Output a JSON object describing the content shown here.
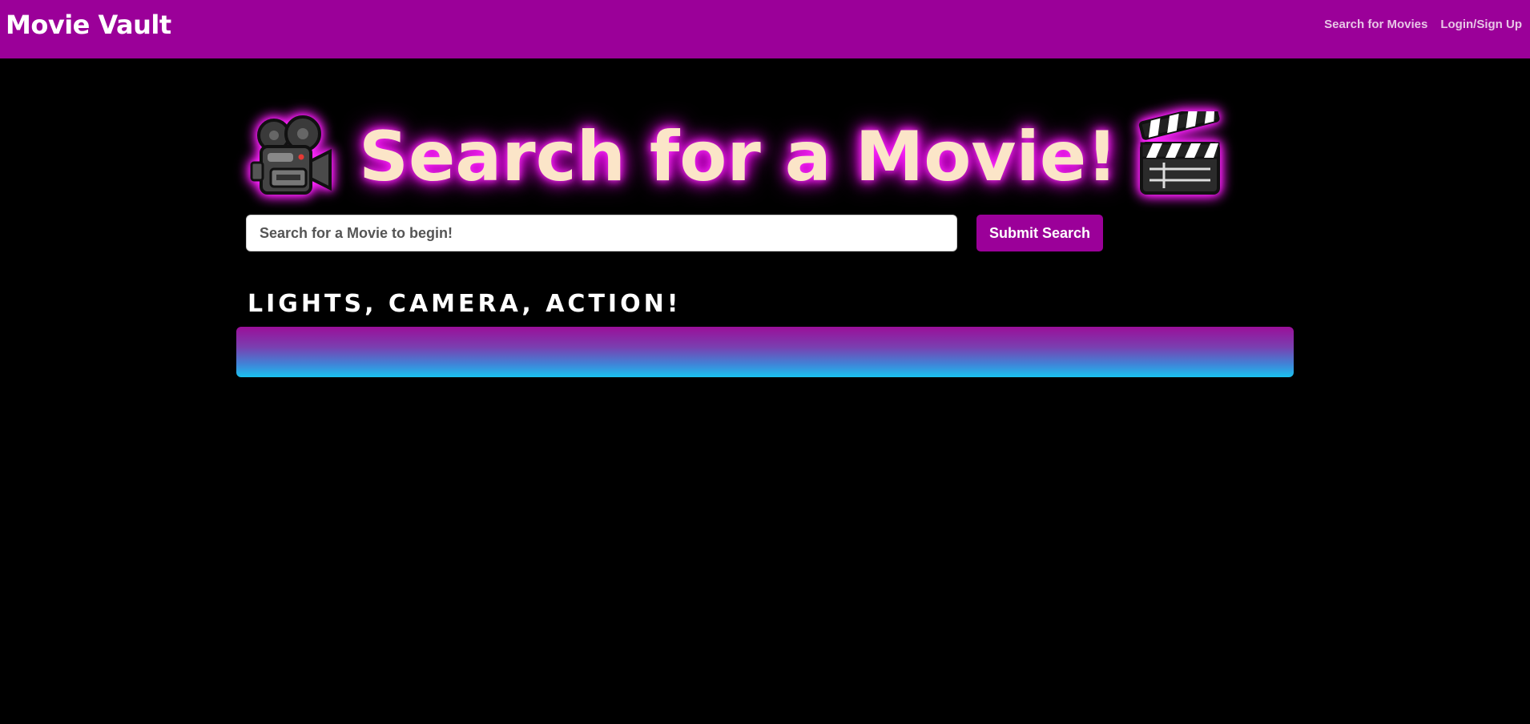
{
  "navbar": {
    "brand": "Movie Vault",
    "links": [
      "Search for Movies",
      "Login/Sign Up"
    ],
    "background_color": "#9b0099"
  },
  "hero": {
    "title": "Search for a Movie!",
    "left_icon": "movie-camera-icon",
    "right_icon": "clapperboard-icon"
  },
  "search": {
    "placeholder": "Search for a Movie to begin!",
    "value": "",
    "submit_label": "Submit Search"
  },
  "section": {
    "subtitle": "LIGHTS, CAMERA, ACTION!"
  },
  "colors": {
    "accent": "#9b0099",
    "title_text": "#fbe5c8",
    "glow": "#ff00ff",
    "gradient_start": "#9b0f99",
    "gradient_end": "#1ac3f0"
  }
}
